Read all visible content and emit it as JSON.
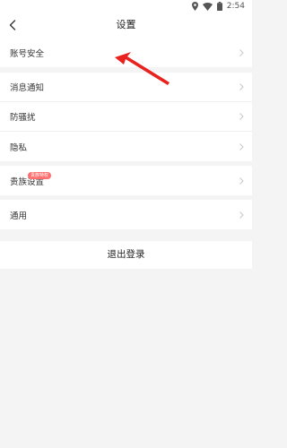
{
  "status_bar": {
    "time": "2:54",
    "icons": [
      "location-icon",
      "wifi-icon",
      "battery-icon"
    ]
  },
  "header": {
    "title": "设置",
    "back_icon": "back-arrow-icon"
  },
  "groups": [
    {
      "items": [
        {
          "label": "账号安全"
        }
      ]
    },
    {
      "items": [
        {
          "label": "消息通知"
        },
        {
          "label": "防骚扰"
        },
        {
          "label": "隐私"
        }
      ]
    },
    {
      "items": [
        {
          "label": "贵族设置",
          "badge": "贵族特权"
        }
      ]
    },
    {
      "items": [
        {
          "label": "通用"
        }
      ]
    }
  ],
  "logout": {
    "label": "退出登录"
  },
  "colors": {
    "background": "#f4f4f4",
    "badge": "#ff6d6d",
    "annotation_arrow": "#e8231f"
  }
}
